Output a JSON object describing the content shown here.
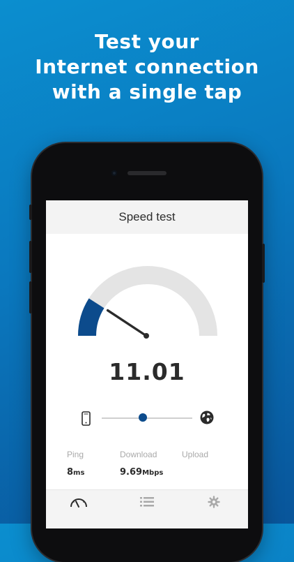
{
  "headline": {
    "line1": "Test your",
    "line2": "Internet connection",
    "line3": "with a single tap"
  },
  "app": {
    "title": "Speed test",
    "speed_value": "11.01",
    "gauge_fill_fraction": 0.18,
    "progress_fraction": 0.45,
    "stats": {
      "ping": {
        "label": "Ping",
        "value": "8",
        "unit": "ms"
      },
      "download": {
        "label": "Download",
        "value": "9.69",
        "unit": "Mbps"
      },
      "upload": {
        "label": "Upload",
        "value": ""
      }
    },
    "tabs": [
      "speedometer-icon",
      "list-icon",
      "gear-icon"
    ]
  },
  "colors": {
    "background_top": "#0b8ecf",
    "background_bottom": "#09559a",
    "accent": "#0c4b8c",
    "gauge_track": "#e4e4e4",
    "needle": "#2b2b2b"
  }
}
